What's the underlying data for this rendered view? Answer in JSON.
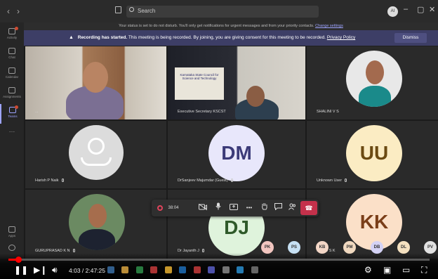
{
  "titlebar": {
    "back": "‹",
    "forward": "›",
    "search_placeholder": "Search",
    "user_initials": "AI",
    "minimize": "–",
    "maximize": "▢",
    "close": "✕"
  },
  "rail": {
    "items": [
      {
        "label": "Activity",
        "badge": true
      },
      {
        "label": "Chat",
        "badge": false
      },
      {
        "label": "Calendar",
        "badge": false
      },
      {
        "label": "Assignments",
        "badge": false
      },
      {
        "label": "Teams",
        "badge": true,
        "active": true
      },
      {
        "label": "…",
        "badge": false
      },
      {
        "label": "Apps",
        "badge": false
      },
      {
        "label": "Help",
        "badge": false
      }
    ]
  },
  "status_banner": {
    "text": "Your status is set to do not disturb. You'll only get notifications for urgent messages and from your priority contacts.",
    "link": "Change settings"
  },
  "recording_banner": {
    "title": "Recording has started.",
    "text": "This meeting is being recorded. By joining, you are giving consent for this meeting to be recorded.",
    "link": "Privacy Policy",
    "dismiss": "Dismiss"
  },
  "participants": {
    "video1_name": "...",
    "video2_name": "Executive Secretary KSCST",
    "shalini": "SHALINI V S",
    "harish": "Harish P Naik",
    "dm_initials": "DM",
    "dm_name": "DrSanjeev Majumdar (Guest)",
    "uu_initials": "UU",
    "uu_name": "Unknown User",
    "guru": "GURUPRASAD K N",
    "dj_initials": "DJ",
    "dj_name": "Dr Jayanth J",
    "kk_initials": "KK",
    "kk_name": "...ANU S K"
  },
  "video2_poster": "Karnataka State Council for Science and Technology",
  "callbar": {
    "timer": "38:04",
    "mic_icon": "mic-icon",
    "share_icon": "share-icon",
    "more": "•••",
    "hangup": "☎"
  },
  "small_avatars": [
    {
      "initials": "PK",
      "color": "#f3c6c0"
    },
    {
      "initials": "PS",
      "color": "#c6e0f3"
    },
    {
      "initials": "KB",
      "color": "#f3d6c6"
    },
    {
      "initials": "PM",
      "color": "#f0d9c0"
    },
    {
      "initials": "DB",
      "color": "#d4d2f5"
    },
    {
      "initials": "DL",
      "color": "#f5e1c0"
    },
    {
      "initials": "PV",
      "color": "#e1e1e1"
    }
  ],
  "youtube": {
    "time": "4:03 / 2:47:25",
    "progress": 0.024
  },
  "colors": {
    "accent": "#9ea4ff",
    "recording_bar": "#3d3e66",
    "hangup": "#c4314b",
    "youtube_red": "#ff0000"
  }
}
